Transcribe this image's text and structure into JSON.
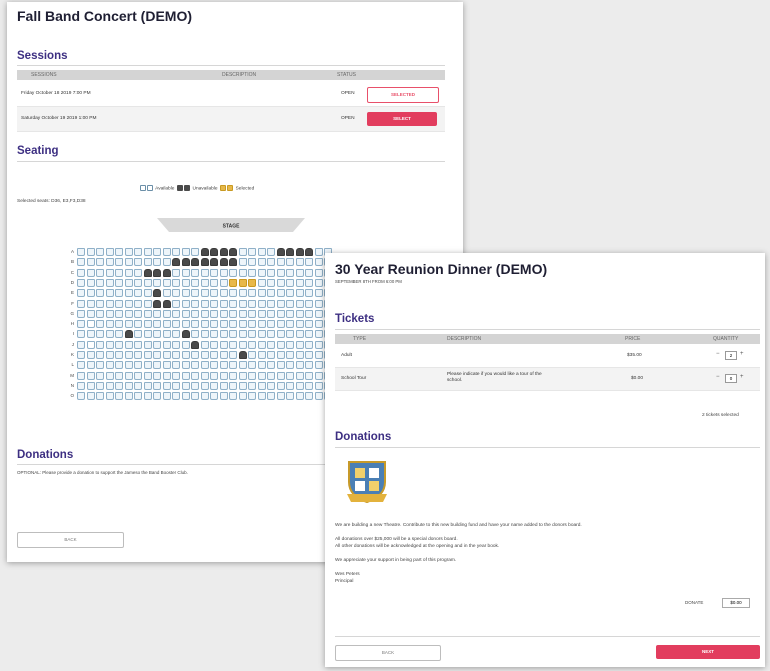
{
  "concert": {
    "title": "Fall Band Concert (DEMO)",
    "sessions_heading": "Sessions",
    "session_cols": [
      "SESSIONS",
      "DESCRIPTION",
      "STATUS"
    ],
    "sessions": [
      {
        "date": "Friday October 18 2019 7:00 PM",
        "status": "OPEN",
        "action": "SELECTED"
      },
      {
        "date": "Saturday October 19 2019 1:00 PM",
        "status": "OPEN",
        "action": "SELECT"
      }
    ],
    "seating_heading": "Seating",
    "legend": {
      "available": "Available",
      "unavailable": "Unavailable",
      "selected": "Selected"
    },
    "selected_seats_text": "Selected seats: D36, E3,F3,D38",
    "stage_label": "STAGE",
    "row_labels": [
      "A",
      "B",
      "C",
      "D",
      "E",
      "F",
      "G",
      "H",
      "I",
      "J",
      "K",
      "L",
      "M",
      "N",
      "O"
    ],
    "donations_heading": "Donations",
    "donations_text": "OPTIONAL: Please provide a donation to support the Jameso the Band Booster Club.",
    "back_label": "BACK"
  },
  "reunion": {
    "title": "30 Year Reunion Dinner (DEMO)",
    "subtitle": "SEPTEMBER 8TH FROM 6:00 PM",
    "tickets_heading": "Tickets",
    "ticket_cols": [
      "TYPE",
      "DESCRIPTION",
      "PRICE",
      "QUANTITY"
    ],
    "tickets": [
      {
        "type": "Adult",
        "description": "",
        "price": "$35.00",
        "qty": "2"
      },
      {
        "type": "School Tour",
        "description": "Please indicate if you would like a tour of the school.",
        "price": "$0.00",
        "qty": "0"
      }
    ],
    "tickets_selected": "2 tickets selected",
    "donations_heading": "Donations",
    "crest_icon": "school-crest-icon",
    "para1": "We are building a new Theatre. Contribute to this new building fund and have your name added to the donors board.",
    "para2a": "All donations over $25,000 will be a special donors board.",
    "para2b": "All other donations will be acknowledged at the opening and in the year book.",
    "para3": "We appreciate your support in being part of this program.",
    "sign_name": "Wes Peters",
    "sign_role": "Principal",
    "amount_label": "DONATE",
    "amount_value": "$0.00",
    "back_label": "BACK",
    "next_label": "NEXT"
  },
  "colors": {
    "heading": "#3d2f82",
    "accent": "#e23d5e",
    "seat_available": "#eef5fa",
    "seat_unavailable": "#4a4a4a",
    "seat_selected": "#e8b84a"
  }
}
